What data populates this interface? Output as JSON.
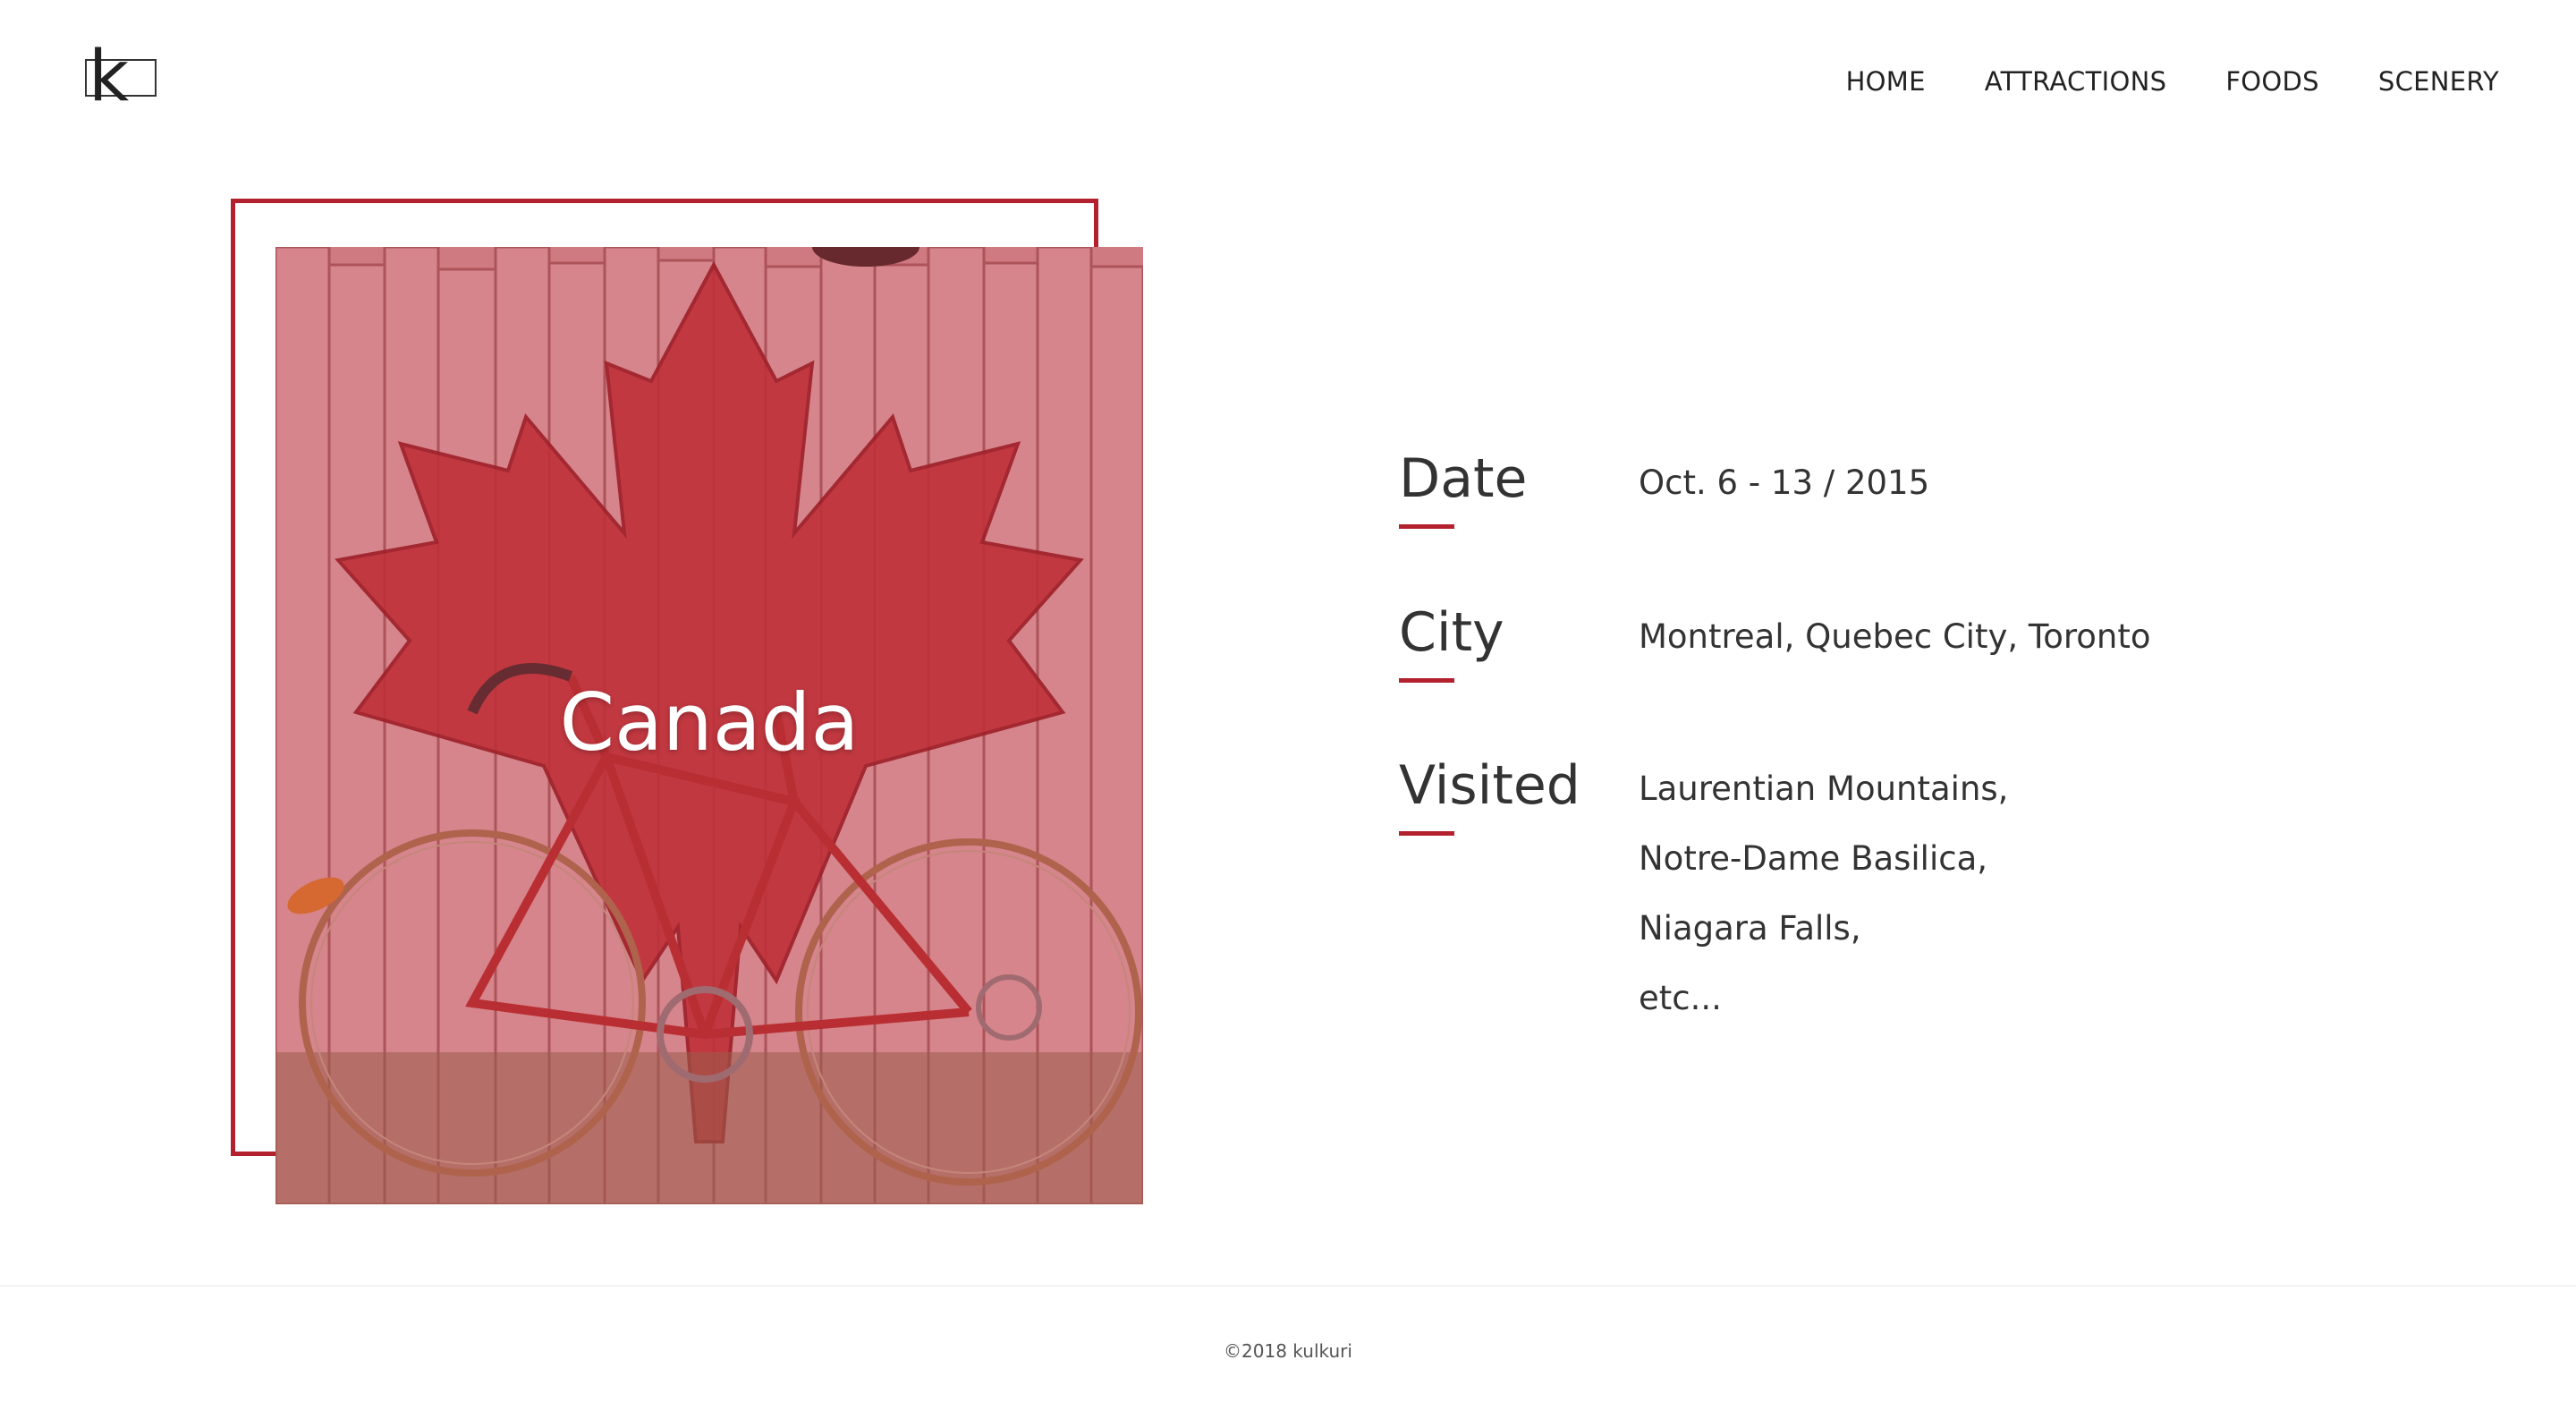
{
  "header": {
    "logo_letter": "k",
    "nav": [
      "HOME",
      "ATTRACTIONS",
      "FOODS",
      "SCENERY"
    ]
  },
  "hero": {
    "title": "Canada",
    "accent_color": "#b3202e"
  },
  "info": {
    "date": {
      "label": "Date",
      "value": "Oct. 6 - 13 / 2015"
    },
    "city": {
      "label": "City",
      "value": "Montreal, Quebec City, Toronto"
    },
    "visited": {
      "label": "Visited",
      "items": [
        "Laurentian Mountains,",
        "Notre-Dame Basilica,",
        "Niagara Falls,",
        "etc..."
      ]
    }
  },
  "footer": {
    "copyright": "©2018 kulkuri"
  }
}
